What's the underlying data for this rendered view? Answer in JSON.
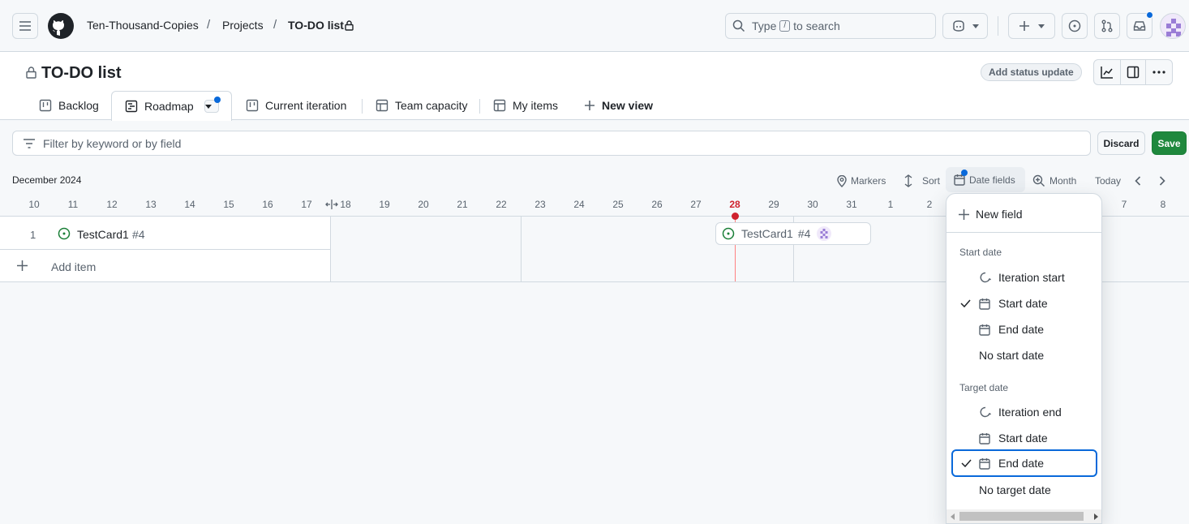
{
  "header": {
    "breadcrumbs": [
      "Ten-Thousand-Copies",
      "Projects",
      "TO-DO list"
    ],
    "separator": "/",
    "search": {
      "prefix": "Type",
      "key": "/",
      "suffix": "to search"
    }
  },
  "project": {
    "title": "TO-DO list",
    "status_button": "Add status update",
    "tabs": [
      {
        "label": "Backlog",
        "icon": "board-icon"
      },
      {
        "label": "Roadmap",
        "icon": "roadmap-icon",
        "active": true
      },
      {
        "label": "Current iteration",
        "icon": "board-icon"
      },
      {
        "label": "Team capacity",
        "icon": "table-icon"
      },
      {
        "label": "My items",
        "icon": "table-icon"
      }
    ],
    "new_view": "New view"
  },
  "filter": {
    "placeholder": "Filter by keyword or by field",
    "discard": "Discard",
    "save": "Save"
  },
  "timeline": {
    "month": "December 2024",
    "controls": {
      "markers": "Markers",
      "sort": "Sort",
      "date_fields": "Date fields",
      "zoom": "Month",
      "today": "Today"
    },
    "days": [
      "10",
      "11",
      "12",
      "13",
      "14",
      "15",
      "16",
      "17",
      "18",
      "19",
      "20",
      "21",
      "22",
      "23",
      "24",
      "25",
      "26",
      "27",
      "28",
      "29",
      "30",
      "31",
      "1",
      "2",
      "7",
      "8"
    ],
    "today_day": "28"
  },
  "items": [
    {
      "index": "1",
      "title": "TestCard1",
      "number": "#4"
    }
  ],
  "add_item": "Add item",
  "bar": {
    "title": "TestCard1",
    "number": "#4"
  },
  "menu": {
    "new_field": "New field",
    "start_group": "Start date",
    "start_options": [
      "Iteration start",
      "Start date",
      "End date",
      "No start date"
    ],
    "target_group": "Target date",
    "target_options": [
      "Iteration end",
      "Start date",
      "End date",
      "No target date"
    ]
  },
  "colors": {
    "accent": "#0969da",
    "save_green": "#1f883d",
    "today_red": "#cf222e",
    "open_issue": "#1a7f37"
  }
}
